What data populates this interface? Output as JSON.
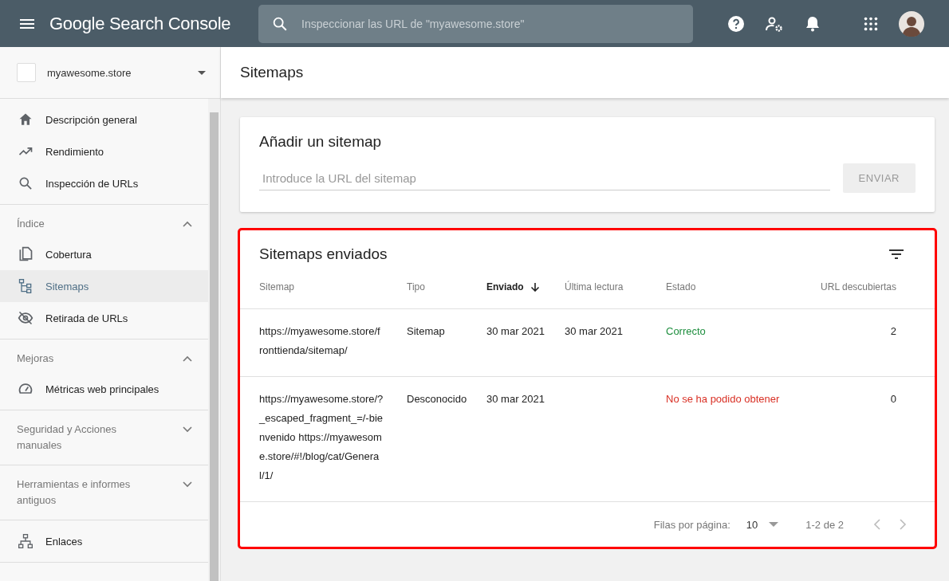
{
  "header": {
    "product": "Google Search Console",
    "search_placeholder": "Inspeccionar las URL de \"myawesome.store\""
  },
  "sidebar": {
    "property": "myawesome.store",
    "sections": [
      {
        "items": [
          {
            "label": "Descripción general",
            "selected": false
          },
          {
            "label": "Rendimiento",
            "selected": false
          },
          {
            "label": "Inspección de URLs",
            "selected": false
          }
        ]
      },
      {
        "title": "Índice",
        "expanded": true,
        "items": [
          {
            "label": "Cobertura",
            "selected": false
          },
          {
            "label": "Sitemaps",
            "selected": true
          },
          {
            "label": "Retirada de URLs",
            "selected": false
          }
        ]
      },
      {
        "title": "Mejoras",
        "expanded": true,
        "items": [
          {
            "label": "Métricas web principales",
            "selected": false
          }
        ]
      },
      {
        "title": "Seguridad y Acciones manuales",
        "expanded": false
      },
      {
        "title": "Herramientas e informes antiguos",
        "expanded": false
      },
      {
        "items": [
          {
            "label": "Enlaces",
            "selected": false
          }
        ]
      }
    ]
  },
  "page_title": "Sitemaps",
  "add_card": {
    "title": "Añadir un sitemap",
    "placeholder": "Introduce la URL del sitemap",
    "button": "ENVIAR"
  },
  "submitted": {
    "title": "Sitemaps enviados",
    "highlighted": true,
    "columns": [
      {
        "label": "Sitemap",
        "sorted": false
      },
      {
        "label": "Tipo",
        "sorted": false
      },
      {
        "label": "Enviado",
        "sorted": true
      },
      {
        "label": "Última lectura",
        "sorted": false
      },
      {
        "label": "Estado",
        "sorted": false
      },
      {
        "label": "URL descubiertas",
        "sorted": false
      }
    ],
    "rows": [
      {
        "sitemap": "https://myawesome.store/fronttienda/sitemap/",
        "type": "Sitemap",
        "submitted": "30 mar 2021",
        "last_read": "30 mar 2021",
        "status": "Correcto",
        "color": "#1e8e3e",
        "urls": "2"
      },
      {
        "sitemap": "https://myawesome.store/?_escaped_fragment_=/-bienvenido https://myawesome.store/#!/blog/cat/General/1/",
        "type": "Desconocido",
        "submitted": "30 mar 2021",
        "last_read": null,
        "status": "No se ha podido obtener",
        "color": "#d93025",
        "urls": "0"
      }
    ],
    "pagination": {
      "rows_label": "Filas por página:",
      "rows_value": "10",
      "range": "1-2 de 2"
    }
  }
}
